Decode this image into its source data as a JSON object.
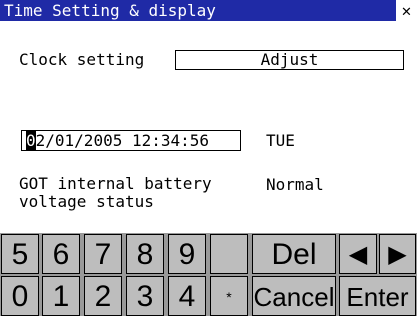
{
  "window": {
    "title": "Time Setting & display",
    "close_glyph": "✕"
  },
  "clock_setting": {
    "label": "Clock setting",
    "value": "Adjust"
  },
  "datetime": {
    "cursor_char": "0",
    "rest": "2/01/2005 12:34:56",
    "day": "TUE"
  },
  "battery": {
    "label": "GOT internal battery\nvoltage status",
    "status": "Normal"
  },
  "keypad": {
    "row1": [
      "5",
      "6",
      "7",
      "8",
      "9",
      "",
      "Del",
      "◀",
      "▶"
    ],
    "row2": [
      "0",
      "1",
      "2",
      "3",
      "4",
      "*",
      "Cancel",
      "Enter"
    ]
  },
  "colors": {
    "title_bar": "#1f2aa6",
    "keypad_bg": "#999999",
    "key_face": "#bdbdbd"
  }
}
